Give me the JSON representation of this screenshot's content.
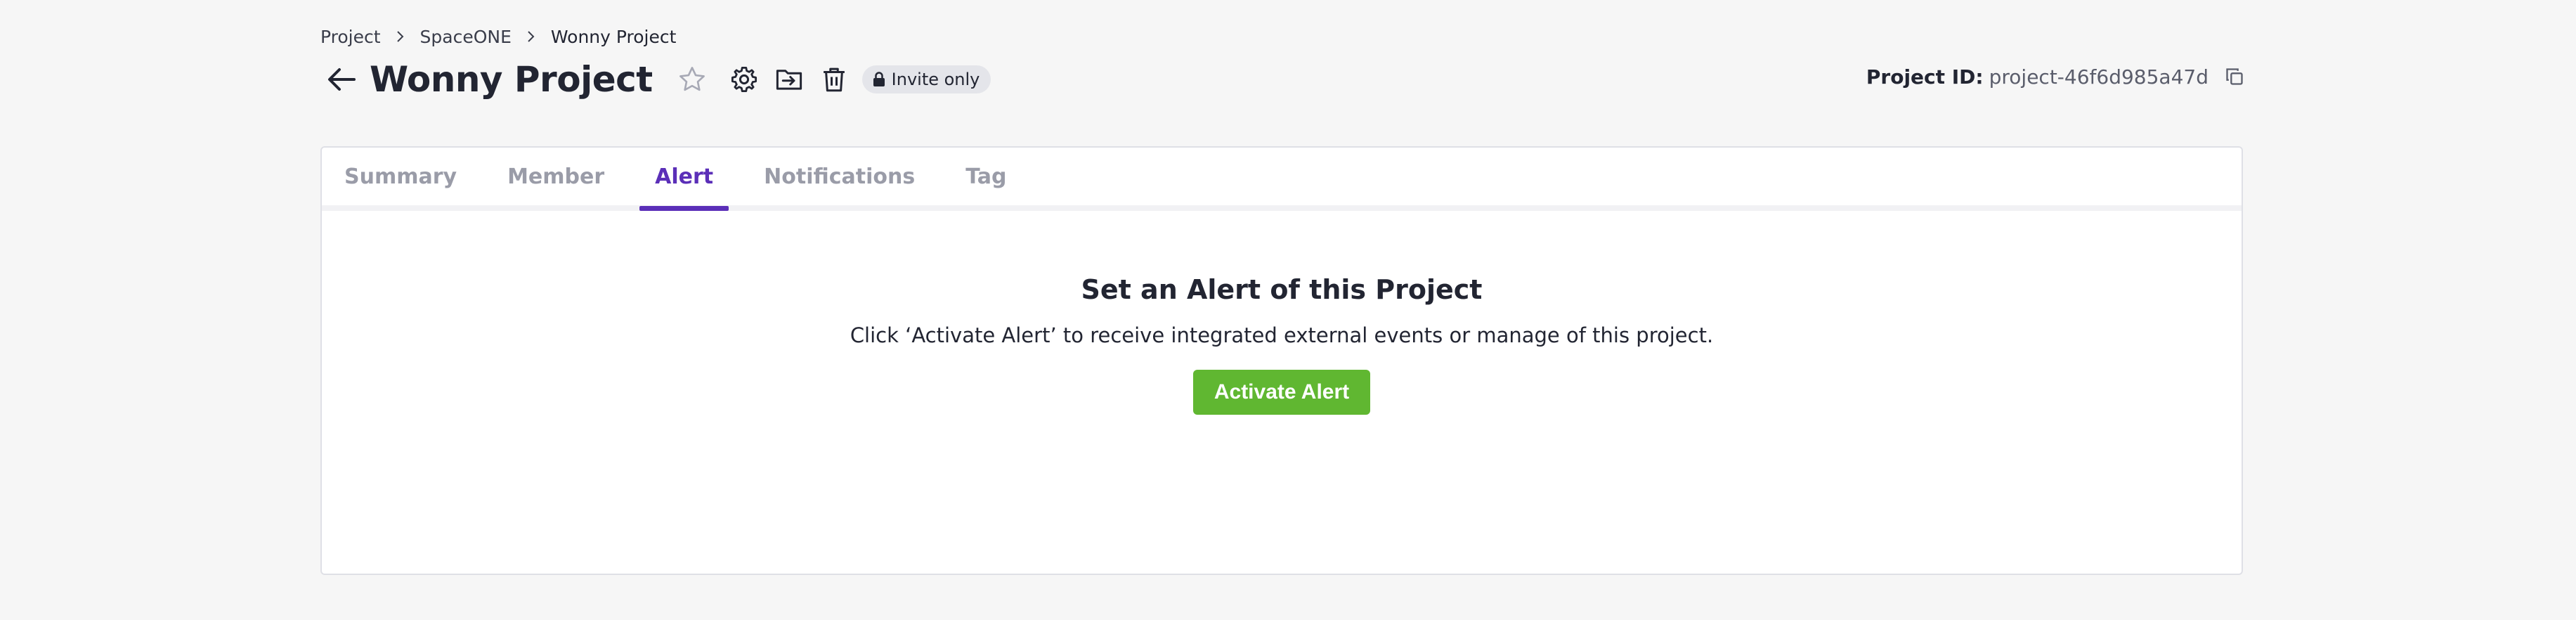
{
  "breadcrumb": {
    "items": [
      {
        "label": "Project"
      },
      {
        "label": "SpaceONE"
      },
      {
        "label": "Wonny Project"
      }
    ]
  },
  "header": {
    "title": "Wonny Project",
    "badge": "Invite only",
    "project_id_label": "Project ID:",
    "project_id_value": "project-46f6d985a47d",
    "icons": [
      "back-arrow-icon",
      "star-icon",
      "gear-icon",
      "move-folder-icon",
      "trash-icon",
      "lock-icon",
      "copy-icon"
    ]
  },
  "tabs": [
    {
      "label": "Summary",
      "active": false
    },
    {
      "label": "Member",
      "active": false
    },
    {
      "label": "Alert",
      "active": true
    },
    {
      "label": "Notifications",
      "active": false
    },
    {
      "label": "Tag",
      "active": false
    }
  ],
  "alert_panel": {
    "title": "Set an Alert of this Project",
    "description": "Click ‘Activate Alert’ to receive integrated external events or manage of this project.",
    "button_label": "Activate Alert"
  },
  "colors": {
    "accent": "#5b2fb8",
    "button_green": "#60b731",
    "background": "#f6f6f6",
    "badge_bg": "#e4e5ea"
  }
}
